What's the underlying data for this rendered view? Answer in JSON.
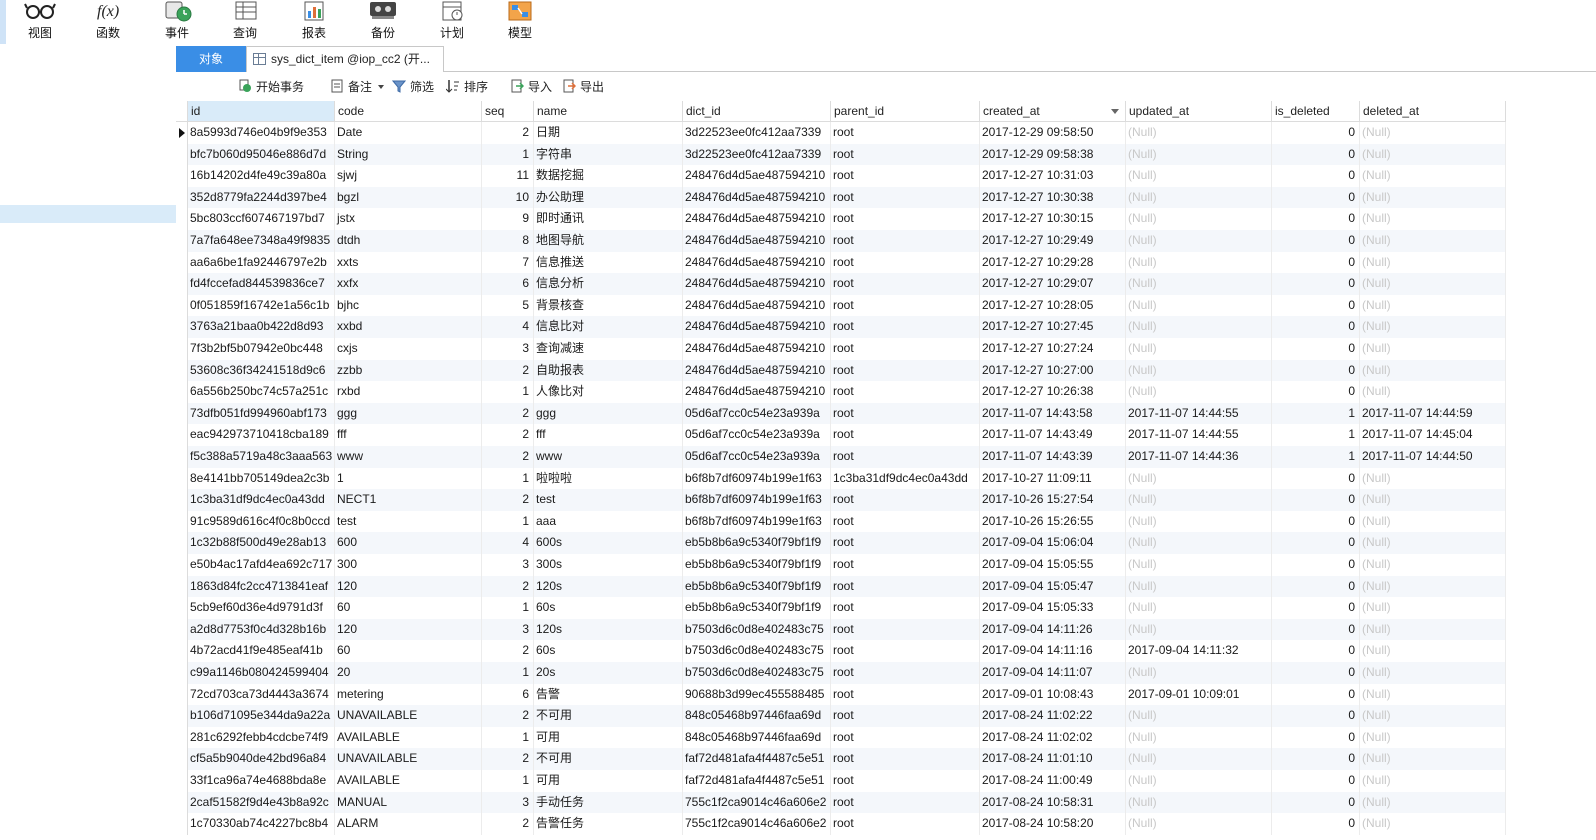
{
  "ribbon": {
    "buttons": [
      {
        "label": "视图",
        "icon": "glasses-icon"
      },
      {
        "label": "函数",
        "icon": "function-icon"
      },
      {
        "label": "事件",
        "icon": "event-clock-icon"
      },
      {
        "label": "查询",
        "icon": "query-table-icon"
      },
      {
        "label": "报表",
        "icon": "report-chart-icon"
      },
      {
        "label": "备份",
        "icon": "backup-icon"
      },
      {
        "label": "计划",
        "icon": "schedule-icon"
      },
      {
        "label": "模型",
        "icon": "model-icon"
      }
    ]
  },
  "tabs": {
    "objects_label": "对象",
    "document_label": "sys_dict_item @iop_cc2 (开..."
  },
  "toolbar": {
    "begin_transaction": "开始事务",
    "notes": "备注",
    "filter": "筛选",
    "sort": "排序",
    "import": "导入",
    "export": "导出"
  },
  "table": {
    "columns": [
      "id",
      "code",
      "seq",
      "name",
      "dict_id",
      "parent_id",
      "created_at",
      "updated_at",
      "is_deleted",
      "deleted_at"
    ],
    "rows": [
      [
        "8a5993d746e04b9f9e353",
        "Date",
        "2",
        "日期",
        "3d22523ee0fc412aa7339",
        "root",
        "2017-12-29 09:58:50",
        "(Null)",
        "0",
        "(Null)"
      ],
      [
        "bfc7b060d95046e886d7d",
        "String",
        "1",
        "字符串",
        "3d22523ee0fc412aa7339",
        "root",
        "2017-12-29 09:58:38",
        "(Null)",
        "0",
        "(Null)"
      ],
      [
        "16b14202d4fe49c39a80a",
        "sjwj",
        "11",
        "数据挖掘",
        "248476d4d5ae487594210",
        "root",
        "2017-12-27 10:31:03",
        "(Null)",
        "0",
        "(Null)"
      ],
      [
        "352d8779fa2244d397be4",
        "bgzl",
        "10",
        "办公助理",
        "248476d4d5ae487594210",
        "root",
        "2017-12-27 10:30:38",
        "(Null)",
        "0",
        "(Null)"
      ],
      [
        "5bc803ccf607467197bd7",
        "jstx",
        "9",
        "即时通讯",
        "248476d4d5ae487594210",
        "root",
        "2017-12-27 10:30:15",
        "(Null)",
        "0",
        "(Null)"
      ],
      [
        "7a7fa648ee7348a49f9835",
        "dtdh",
        "8",
        "地图导航",
        "248476d4d5ae487594210",
        "root",
        "2017-12-27 10:29:49",
        "(Null)",
        "0",
        "(Null)"
      ],
      [
        "aa6a6be1fa92446797e2b",
        "xxts",
        "7",
        "信息推送",
        "248476d4d5ae487594210",
        "root",
        "2017-12-27 10:29:28",
        "(Null)",
        "0",
        "(Null)"
      ],
      [
        "fd4fccefad844539836ce7",
        "xxfx",
        "6",
        "信息分析",
        "248476d4d5ae487594210",
        "root",
        "2017-12-27 10:29:07",
        "(Null)",
        "0",
        "(Null)"
      ],
      [
        "0f051859f16742e1a56c1b",
        "bjhc",
        "5",
        "背景核查",
        "248476d4d5ae487594210",
        "root",
        "2017-12-27 10:28:05",
        "(Null)",
        "0",
        "(Null)"
      ],
      [
        "3763a21baa0b422d8d93",
        "xxbd",
        "4",
        "信息比对",
        "248476d4d5ae487594210",
        "root",
        "2017-12-27 10:27:45",
        "(Null)",
        "0",
        "(Null)"
      ],
      [
        "7f3b2bf5b07942e0bc448",
        "cxjs",
        "3",
        "查询减速",
        "248476d4d5ae487594210",
        "root",
        "2017-12-27 10:27:24",
        "(Null)",
        "0",
        "(Null)"
      ],
      [
        "53608c36f34241518d9c6",
        "zzbb",
        "2",
        "自助报表",
        "248476d4d5ae487594210",
        "root",
        "2017-12-27 10:27:00",
        "(Null)",
        "0",
        "(Null)"
      ],
      [
        "6a556b250bc74c57a251c",
        "rxbd",
        "1",
        "人像比对",
        "248476d4d5ae487594210",
        "root",
        "2017-12-27 10:26:38",
        "(Null)",
        "0",
        "(Null)"
      ],
      [
        "73dfb051fd994960abf173",
        "ggg",
        "2",
        "ggg",
        "05d6af7cc0c54e23a939a",
        "root",
        "2017-11-07 14:43:58",
        "2017-11-07 14:44:55",
        "1",
        "2017-11-07 14:44:59"
      ],
      [
        "eac942973710418cba189",
        "fff",
        "2",
        "fff",
        "05d6af7cc0c54e23a939a",
        "root",
        "2017-11-07 14:43:49",
        "2017-11-07 14:44:55",
        "1",
        "2017-11-07 14:45:04"
      ],
      [
        "f5c388a5719a48c3aaa563",
        "www",
        "2",
        "www",
        "05d6af7cc0c54e23a939a",
        "root",
        "2017-11-07 14:43:39",
        "2017-11-07 14:44:36",
        "1",
        "2017-11-07 14:44:50"
      ],
      [
        "8e4141bb705149dea2c3b",
        "1",
        "1",
        "啦啦啦",
        "b6f8b7df60974b199e1f63",
        "1c3ba31df9dc4ec0a43dd",
        "2017-10-27 11:09:11",
        "(Null)",
        "0",
        "(Null)"
      ],
      [
        "1c3ba31df9dc4ec0a43dd",
        "NECT1",
        "2",
        "test",
        "b6f8b7df60974b199e1f63",
        "root",
        "2017-10-26 15:27:54",
        "(Null)",
        "0",
        "(Null)"
      ],
      [
        "91c9589d616c4f0c8b0ccd",
        "test",
        "1",
        "aaa",
        "b6f8b7df60974b199e1f63",
        "root",
        "2017-10-26 15:26:55",
        "(Null)",
        "0",
        "(Null)"
      ],
      [
        "1c32b88f500d49e28ab13",
        "600",
        "4",
        "600s",
        "eb5b8b6a9c5340f79bf1f9",
        "root",
        "2017-09-04 15:06:04",
        "(Null)",
        "0",
        "(Null)"
      ],
      [
        "e50b4ac17afd4ea692c717",
        "300",
        "3",
        "300s",
        "eb5b8b6a9c5340f79bf1f9",
        "root",
        "2017-09-04 15:05:55",
        "(Null)",
        "0",
        "(Null)"
      ],
      [
        "1863d84fc2cc4713841eaf",
        "120",
        "2",
        "120s",
        "eb5b8b6a9c5340f79bf1f9",
        "root",
        "2017-09-04 15:05:47",
        "(Null)",
        "0",
        "(Null)"
      ],
      [
        "5cb9ef60d36e4d9791d3f",
        "60",
        "1",
        "60s",
        "eb5b8b6a9c5340f79bf1f9",
        "root",
        "2017-09-04 15:05:33",
        "(Null)",
        "0",
        "(Null)"
      ],
      [
        "a2d8d7753f0c4d328b16b",
        "120",
        "3",
        "120s",
        "b7503d6c0d8e402483c75",
        "root",
        "2017-09-04 14:11:26",
        "(Null)",
        "0",
        "(Null)"
      ],
      [
        "4b72acd41f9e485eaf41b",
        "60",
        "2",
        "60s",
        "b7503d6c0d8e402483c75",
        "root",
        "2017-09-04 14:11:16",
        "2017-09-04 14:11:32",
        "0",
        "(Null)"
      ],
      [
        "c99a1146b080424599404",
        "20",
        "1",
        "20s",
        "b7503d6c0d8e402483c75",
        "root",
        "2017-09-04 14:11:07",
        "(Null)",
        "0",
        "(Null)"
      ],
      [
        "72cd703ca73d4443a3674",
        "metering",
        "6",
        "告警",
        "90688b3d99ec455588485",
        "root",
        "2017-09-01 10:08:43",
        "2017-09-01 10:09:01",
        "0",
        "(Null)"
      ],
      [
        "b106d71095e344da9a22a",
        "UNAVAILABLE",
        "2",
        "不可用",
        "848c05468b97446faa69d",
        "root",
        "2017-08-24 11:02:22",
        "(Null)",
        "0",
        "(Null)"
      ],
      [
        "281c6292febb4cdcbe74f9",
        "AVAILABLE",
        "1",
        "可用",
        "848c05468b97446faa69d",
        "root",
        "2017-08-24 11:02:02",
        "(Null)",
        "0",
        "(Null)"
      ],
      [
        "cf5a5b9040de42bd96a84",
        "UNAVAILABLE",
        "2",
        "不可用",
        "faf72d481afa4f4487c5e51",
        "root",
        "2017-08-24 11:01:10",
        "(Null)",
        "0",
        "(Null)"
      ],
      [
        "33f1ca96a74e4688bda8e",
        "AVAILABLE",
        "1",
        "可用",
        "faf72d481afa4f4487c5e51",
        "root",
        "2017-08-24 11:00:49",
        "(Null)",
        "0",
        "(Null)"
      ],
      [
        "2caf51582f9d4e43b8a92c",
        "MANUAL",
        "3",
        "手动任务",
        "755c1f2ca9014c46a606e2",
        "root",
        "2017-08-24 10:58:31",
        "(Null)",
        "0",
        "(Null)"
      ],
      [
        "1c70330ab74c4227bc8b4",
        "ALARM",
        "2",
        "告警任务",
        "755c1f2ca9014c46a606e2",
        "root",
        "2017-08-24 10:58:20",
        "(Null)",
        "0",
        "(Null)"
      ]
    ]
  }
}
